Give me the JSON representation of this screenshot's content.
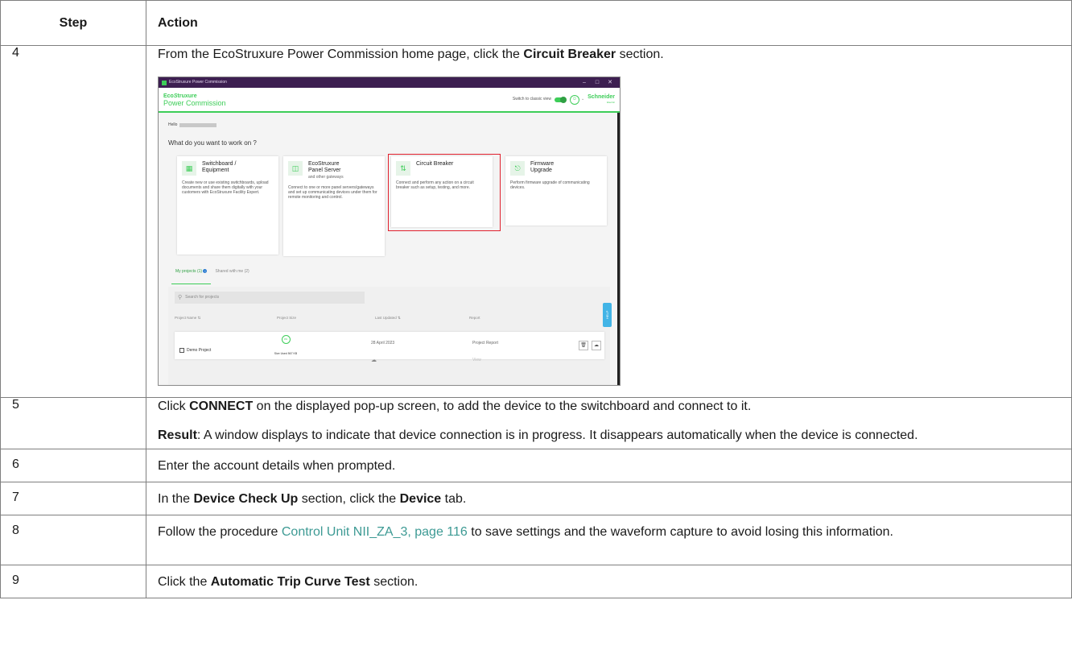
{
  "table": {
    "headers": {
      "step": "Step",
      "action": "Action"
    },
    "rows": [
      {
        "step": "4",
        "parts": [
          {
            "text": "From the EcoStruxure Power Commission home page, click the "
          },
          {
            "text": "Circuit Breaker",
            "bold": true
          },
          {
            "text": " section."
          }
        ]
      },
      {
        "step": "5",
        "parts": [
          {
            "text": "Click "
          },
          {
            "text": "CONNECT",
            "bold": true
          },
          {
            "text": " on the displayed pop-up screen, to add the device to the switchboard and connect to it."
          }
        ],
        "result_label": "Result",
        "result_text": ": A window displays to indicate that device connection is in progress. It disappears automatically when the device is connected."
      },
      {
        "step": "6",
        "parts": [
          {
            "text": "Enter the account details when prompted."
          }
        ]
      },
      {
        "step": "7",
        "parts": [
          {
            "text": "In the "
          },
          {
            "text": "Device Check Up",
            "bold": true
          },
          {
            "text": " section, click the "
          },
          {
            "text": "Device",
            "bold": true
          },
          {
            "text": " tab."
          }
        ]
      },
      {
        "step": "8",
        "parts": [
          {
            "text": "Follow the procedure "
          },
          {
            "text": "Control Unit NII_ZA_3, page 116",
            "link": true
          },
          {
            "text": " to save settings and the waveform capture to avoid losing this information."
          }
        ]
      },
      {
        "step": "9",
        "parts": [
          {
            "text": "Click the "
          },
          {
            "text": "Automatic Trip Curve Test",
            "bold": true
          },
          {
            "text": " section."
          }
        ]
      }
    ]
  },
  "screenshot": {
    "window_title": "EcoStruxure Power Commission",
    "window_controls": [
      "–",
      "□",
      "✕"
    ],
    "logo_line1": "Eco",
    "logo_line1_b": "truxure",
    "logo_line2": "Power Commission",
    "switch_label": "Switch to classic view",
    "brand": "Schneider",
    "brand_sub": "Electric",
    "hello": "Hello",
    "question": "What do you want to work on ?",
    "cards": {
      "switchboard": {
        "title1": "Switchboard /",
        "title2": "Equipment",
        "desc": "Create new or use existing switchboards, upload documents and share them digitally with your customers with EcoStruxure Facility Expert."
      },
      "panel_server": {
        "title1": "EcoStruxure",
        "title2": "Panel Server",
        "sub": "and other gateways",
        "desc": "Connect to one or more panel servers/gateways and set up communicating devices under them for remote monitoring and control."
      },
      "circuit_breaker": {
        "title1": "Circuit Breaker",
        "desc": "Connect and perform any action on a circuit breaker such as setup, testing, and more."
      },
      "firmware": {
        "title1": "Firmware",
        "title2": "Upgrade",
        "desc": "Perform firmware upgrade of communicating devices."
      }
    },
    "tabs": {
      "my_projects": "My projects (1)",
      "shared": "Shared with me (2)"
    },
    "search_placeholder": "Search for projects",
    "columns": {
      "name": "Project Name",
      "size": "Project Size",
      "updated": "Last Updated",
      "report": "Report"
    },
    "project": {
      "name": "Demo Project",
      "size_pct": "0%",
      "size_used": "Size Used 567 KB",
      "updated": "28 April 2023",
      "report": "Project Report",
      "report_action": "View"
    },
    "help_label": "HELP",
    "accent_color": "#3dcd58",
    "highlight_color": "#e0202d"
  }
}
